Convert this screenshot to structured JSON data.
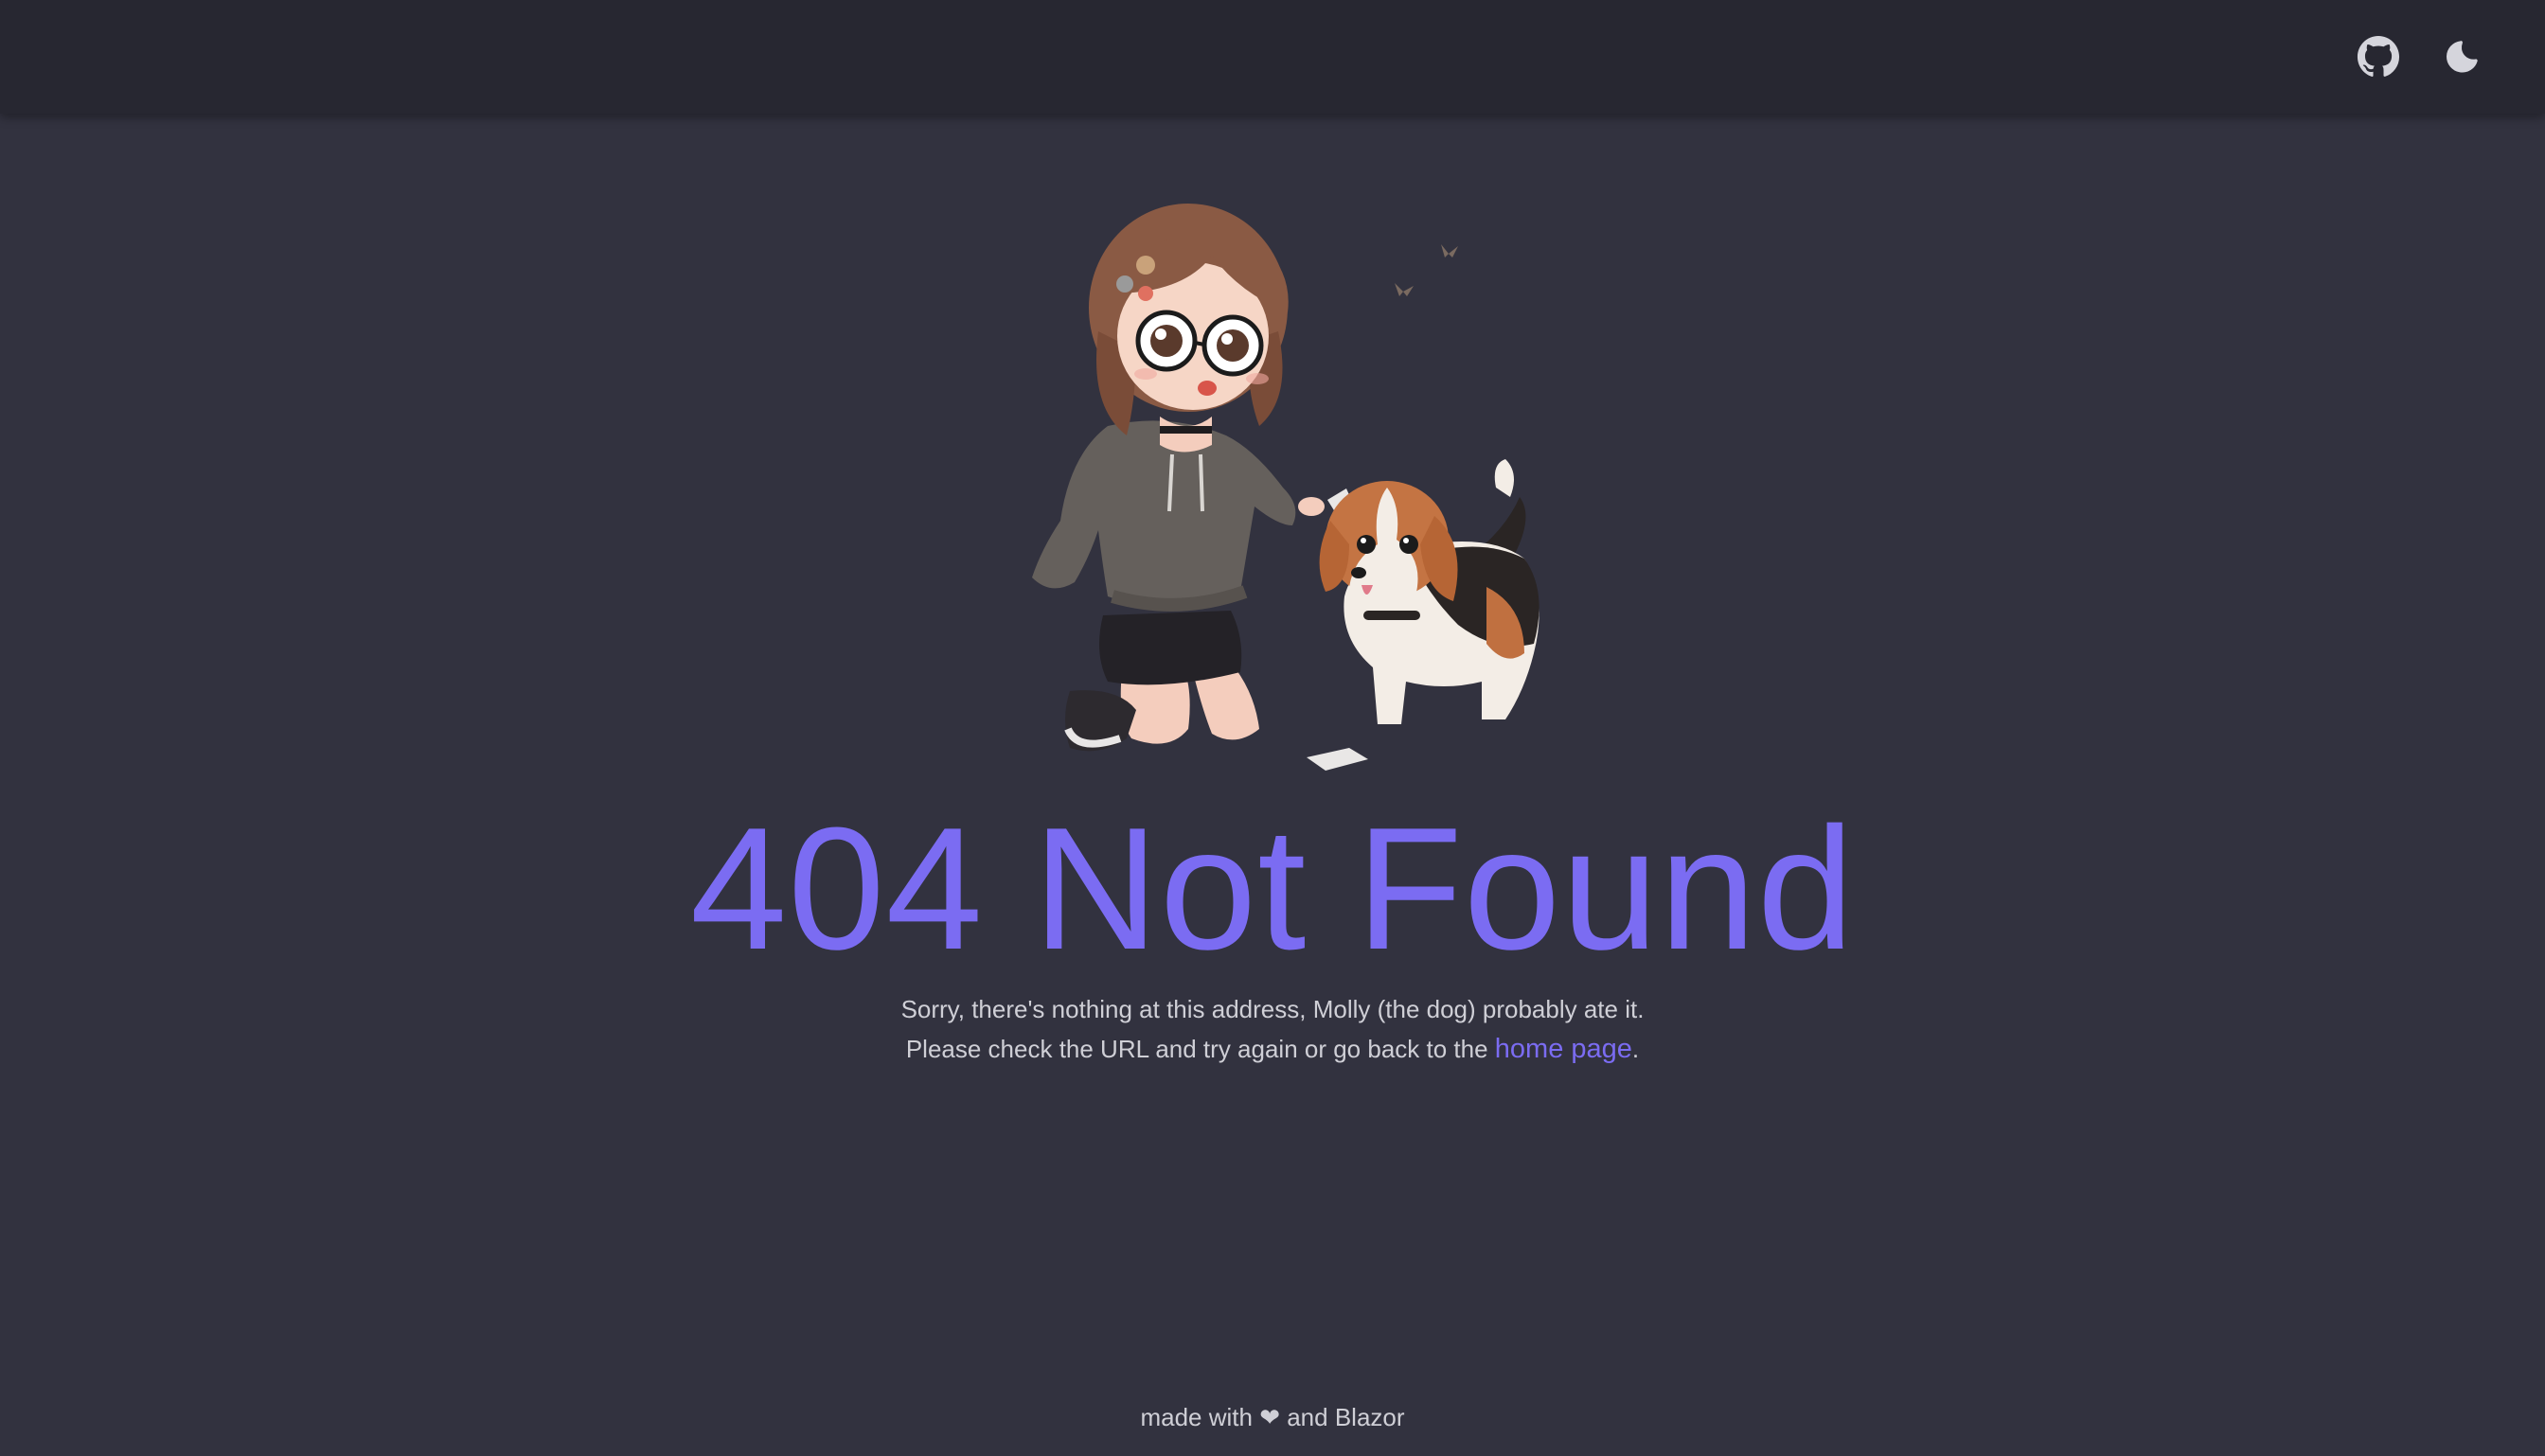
{
  "colors": {
    "background": "#32323f",
    "appbar": "#272731",
    "accent": "#7b6cf2",
    "text": "#cfcfd6",
    "icon": "#d5d5dc"
  },
  "appbar": {
    "github_icon": "github-icon",
    "theme_icon": "moon-icon"
  },
  "illustration": {
    "subject": "anime-girl-with-glasses-and-beagle-puppy"
  },
  "title": "404 Not Found",
  "message": {
    "line1": "Sorry, there's nothing at this address, Molly (the dog) probably ate it.",
    "line2_prefix": "Please check the URL and try again or go back to the ",
    "link_text": "home page",
    "line2_suffix": "."
  },
  "footer": {
    "prefix": "made with",
    "heart": "❤",
    "suffix": "and Blazor"
  }
}
